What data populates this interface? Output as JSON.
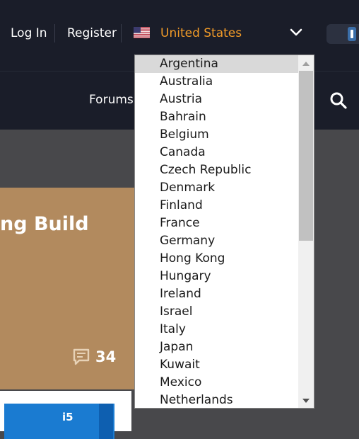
{
  "header": {
    "login_label": "Log In",
    "register_label": "Register",
    "country_label": "United States"
  },
  "subnav": {
    "forums_label": "Forums"
  },
  "card": {
    "title_fragment": "ng Build",
    "comment_count": "34"
  },
  "card2": {
    "badge_text": "i5"
  },
  "dropdown": {
    "selected": "Argentina",
    "options": [
      "Argentina",
      "Australia",
      "Austria",
      "Bahrain",
      "Belgium",
      "Canada",
      "Czech Republic",
      "Denmark",
      "Finland",
      "France",
      "Germany",
      "Hong Kong",
      "Hungary",
      "Ireland",
      "Israel",
      "Italy",
      "Japan",
      "Kuwait",
      "Mexico",
      "Netherlands"
    ]
  },
  "colors": {
    "header_bg": "#1a1d29",
    "accent_orange": "#f09a28",
    "card_tan": "#b28a5e",
    "page_bg": "#48484b"
  },
  "icons": [
    "us-flag-icon",
    "chevron-down-icon",
    "search-icon",
    "comment-icon",
    "scroll-up-arrow-icon",
    "scroll-down-arrow-icon"
  ]
}
